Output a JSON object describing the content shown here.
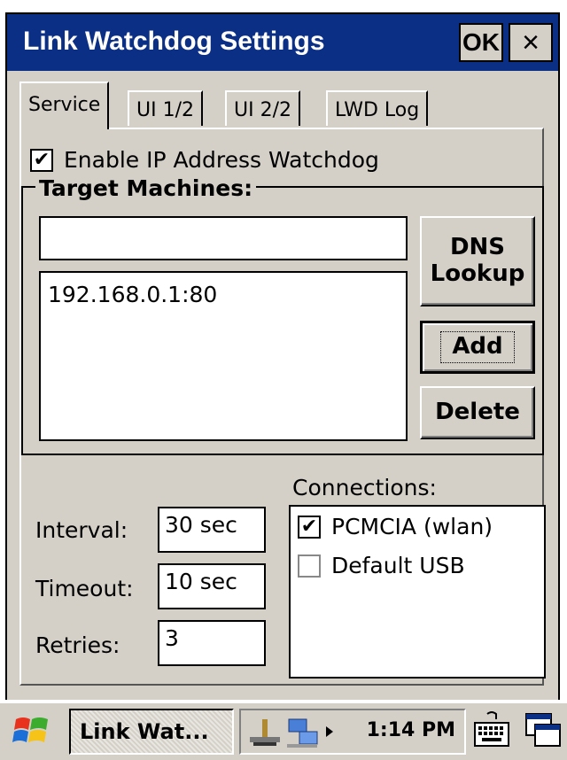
{
  "window": {
    "title": "Link Watchdog Settings",
    "ok_label": "OK",
    "close_label": "×"
  },
  "tabs": [
    {
      "label": "Service",
      "active": true
    },
    {
      "label": "UI 1/2",
      "active": false
    },
    {
      "label": "UI 2/2",
      "active": false
    },
    {
      "label": "LWD Log",
      "active": false
    }
  ],
  "service": {
    "enable_label": "Enable IP Address Watchdog",
    "enable_checked": true,
    "target_group_title": "Target Machines:",
    "target_input_value": "",
    "targets": [
      "192.168.0.1:80"
    ],
    "dns_lookup_label": "DNS\nLookup",
    "add_label": "Add",
    "delete_label": "Delete",
    "interval_label": "Interval:",
    "interval_value": "30 sec",
    "timeout_label": "Timeout:",
    "timeout_value": "10 sec",
    "retries_label": "Retries:",
    "retries_value": "3",
    "connections_label": "Connections:",
    "connections": [
      {
        "label": "PCMCIA (wlan)",
        "checked": true
      },
      {
        "label": "Default USB",
        "checked": false
      }
    ]
  },
  "taskbar": {
    "task_label": "Link Wat...",
    "clock": "1:14 PM",
    "start_icon": "windows-flag-icon",
    "tray_icons": [
      "network-icon",
      "connectivity-icon",
      "tray-arrow-icon"
    ],
    "keyboard_icon": "keyboard-icon",
    "switch_icon": "window-switch-icon"
  },
  "colors": {
    "titlebar": "#0c2f86",
    "face": "#d4d0c8"
  }
}
